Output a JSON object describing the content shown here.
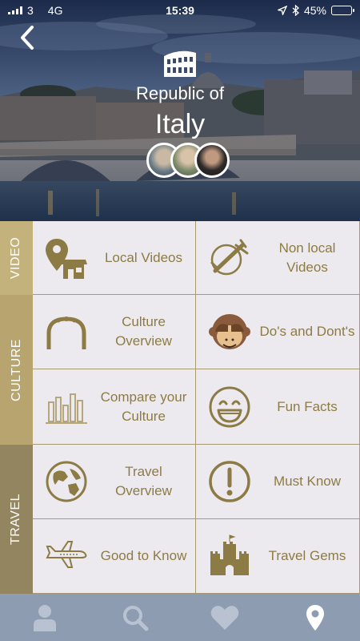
{
  "status": {
    "carrier": "3",
    "network": "4G",
    "time": "15:39",
    "battery": "45%",
    "battery_level": 0.45
  },
  "header": {
    "subtitle": "Republic of",
    "country": "Italy",
    "back_icon": "chevron-left-icon",
    "landmark_icon": "colosseum-icon"
  },
  "sections": [
    {
      "label": "VIDEO",
      "color": "#c4b27c"
    },
    {
      "label": "CULTURE",
      "color": "#b7a46f"
    },
    {
      "label": "TRAVEL",
      "color": "#948561"
    }
  ],
  "cells": {
    "local_videos": {
      "label": "Local Videos",
      "icon": "location-shop-icon"
    },
    "non_local_videos": {
      "label": "Non local Videos",
      "icon": "plane-globe-icon"
    },
    "culture_overview": {
      "label": "Culture Overview",
      "icon": "arch-icon"
    },
    "dos_and_donts": {
      "label": "Do's and Dont's",
      "icon": "see-no-evil-monkey-icon"
    },
    "compare_culture": {
      "label": "Compare your Culture",
      "icon": "bar-chart-icon"
    },
    "fun_facts": {
      "label": "Fun Facts",
      "icon": "grinning-face-icon"
    },
    "travel_overview": {
      "label": "Travel Overview",
      "icon": "globe-icon"
    },
    "must_know": {
      "label": "Must Know",
      "icon": "exclamation-circle-icon"
    },
    "good_to_know": {
      "label": "Good to Know",
      "icon": "airplane-icon"
    },
    "travel_gems": {
      "label": "Travel Gems",
      "icon": "castle-icon"
    }
  },
  "colors": {
    "accent": "#8d7b45",
    "cell_bg": "#eceaef",
    "tabbar": "#8e9cb2"
  },
  "tabs": [
    {
      "icon": "person-icon"
    },
    {
      "icon": "search-icon"
    },
    {
      "icon": "heart-icon"
    },
    {
      "icon": "location-pin-icon",
      "active": true
    }
  ]
}
